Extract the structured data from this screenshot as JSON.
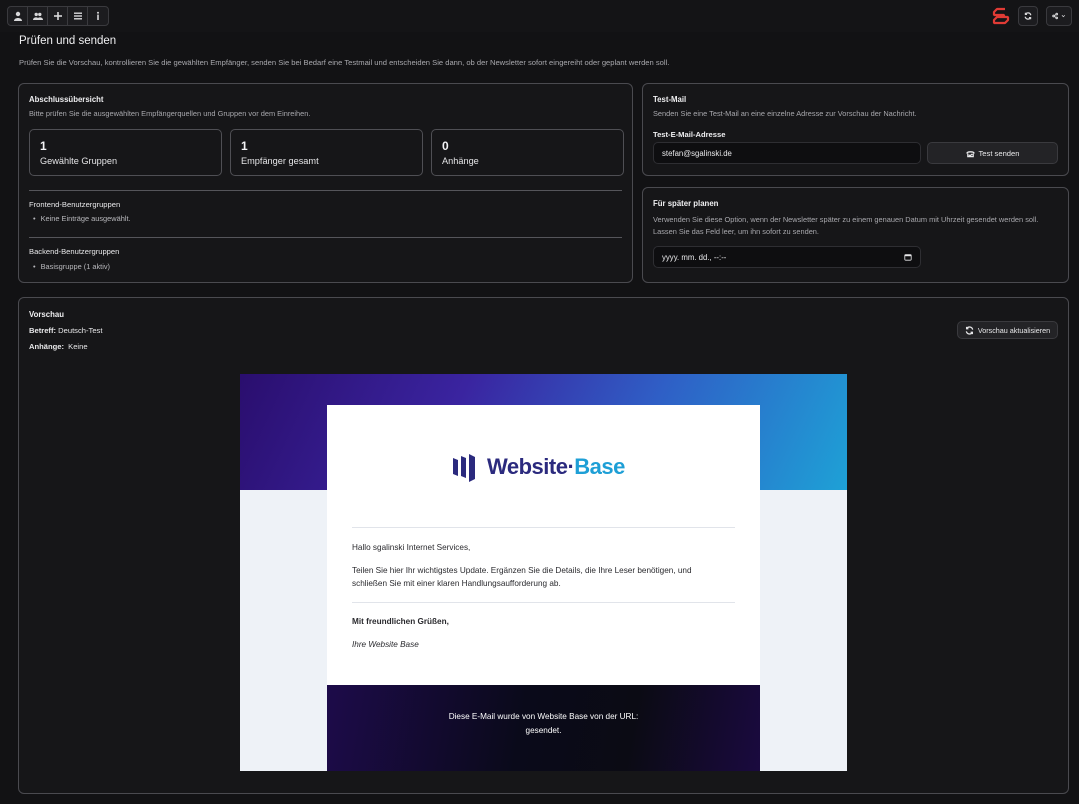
{
  "toolbar": {
    "icons": [
      "user-icon",
      "users-icon",
      "plus-icon",
      "list-icon",
      "info-icon"
    ],
    "right_icons": [
      "brand-logo-icon",
      "refresh-icon",
      "share-icon",
      "chevron-down-icon"
    ]
  },
  "page": {
    "title": "Prüfen und senden",
    "description": "Prüfen Sie die Vorschau, kontrollieren Sie die gewählten Empfänger, senden Sie bei Bedarf eine Testmail und entscheiden Sie dann, ob der Newsletter sofort eingereiht oder geplant werden soll."
  },
  "summary": {
    "title": "Abschlussübersicht",
    "subtitle": "Bitte prüfen Sie die ausgewählten Empfängerquellen und Gruppen vor dem Einreihen.",
    "stats": [
      {
        "value": "1",
        "label": "Gewählte Gruppen"
      },
      {
        "value": "1",
        "label": "Empfänger gesamt"
      },
      {
        "value": "0",
        "label": "Anhänge"
      }
    ],
    "frontend_heading": "Frontend-Benutzergruppen",
    "frontend_items": [
      "Keine Einträge ausgewählt."
    ],
    "backend_heading": "Backend-Benutzergruppen",
    "backend_items": [
      "Basisgruppe (1 aktiv)"
    ]
  },
  "test_mail": {
    "title": "Test-Mail",
    "subtitle": "Senden Sie eine Test-Mail an eine einzelne Adresse zur Vorschau der Nachricht.",
    "field_label": "Test-E-Mail-Adresse",
    "email_value": "stefan@sgalinski.de",
    "send_button": "Test senden"
  },
  "schedule": {
    "title": "Für später planen",
    "description": "Verwenden Sie diese Option, wenn der Newsletter später zu einem genauen Datum mit Uhrzeit gesendet werden soll. Lassen Sie das Feld leer, um ihn sofort zu senden.",
    "date_placeholder": "yyyy. mm. dd., --:--"
  },
  "preview": {
    "title": "Vorschau",
    "subject_label": "Betreff:",
    "subject_value": "Deutsch-Test",
    "attachments_label": "Anhänge:",
    "attachments_value": "Keine",
    "refresh_button": "Vorschau aktualisieren",
    "email": {
      "logo_text_1": "Website",
      "logo_text_2": "Base",
      "greeting": "Hallo sgalinski Internet Services,",
      "body_line_1": "Teilen Sie hier Ihr wichtigstes Update. Ergänzen Sie die Details, die Ihre Leser benötigen, und",
      "body_line_2": "schließen Sie mit einer klaren Handlungsaufforderung ab.",
      "closing": "Mit freundlichen Grüßen,",
      "signature": "Ihre Website Base",
      "footer_line_1": "Diese E-Mail wurde von Website Base von der URL:",
      "footer_line_2": "gesendet.",
      "colors": {
        "hero_start": "#2a0e6e",
        "hero_end": "#1ea1d6",
        "logo_dark": "#2b2a7e",
        "logo_accent": "#1e9fd6"
      }
    }
  }
}
